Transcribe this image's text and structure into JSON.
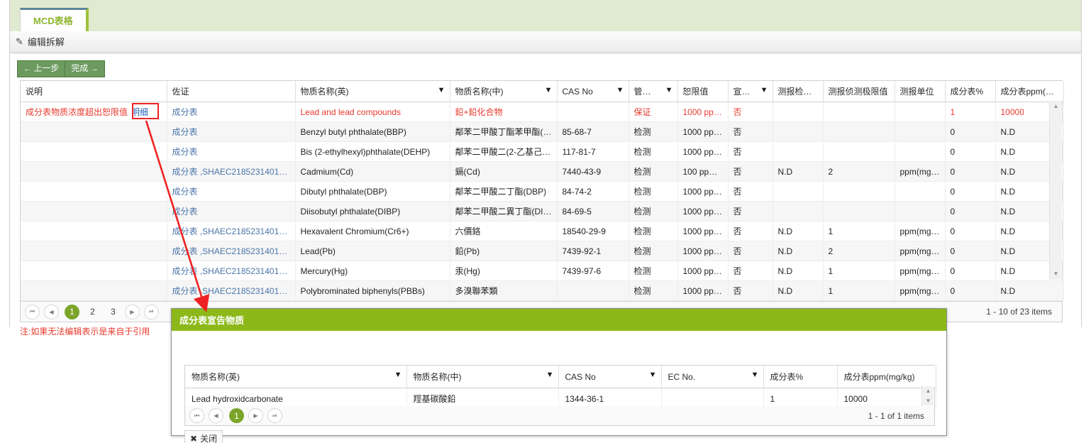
{
  "tab": {
    "label": "MCD表格"
  },
  "toolbar": {
    "icon": "pencil-edit-icon",
    "label": "编辑拆解"
  },
  "actions": {
    "prev_label": "上一步",
    "prev_arrow": "←",
    "done_label": "完成",
    "done_arrow": "→"
  },
  "grid": {
    "columns": [
      {
        "label": "说明",
        "filter": false
      },
      {
        "label": "佐证",
        "filter": false
      },
      {
        "label": "物质名称(英)",
        "filter": true
      },
      {
        "label": "物质名称(中)",
        "filter": true
      },
      {
        "label": "CAS No",
        "filter": true
      },
      {
        "label": "管…",
        "filter": true
      },
      {
        "label": "恕限值",
        "filter": false
      },
      {
        "label": "宣…",
        "filter": true
      },
      {
        "label": "测报检…",
        "filter": false
      },
      {
        "label": "测报侦测极限值",
        "filter": false
      },
      {
        "label": "测报单位",
        "filter": false
      },
      {
        "label": "成分表%",
        "filter": false
      },
      {
        "label": "成分表ppm(…",
        "filter": false
      }
    ],
    "rows": [
      {
        "note": "成分表物质浓度超出恕限值",
        "detail_link": "明细",
        "evidence": "成分表",
        "name_en": "Lead and lead compounds",
        "name_zh": "鉛+鉛化合物",
        "cas": "",
        "control": "保证",
        "limit": "1000 pp…",
        "declare": "否",
        "test_result": "",
        "test_detect_limit": "",
        "test_unit": "",
        "pct": "1",
        "ppm": "10000",
        "highlight": true
      },
      {
        "note": "",
        "detail_link": "",
        "evidence": "成分表",
        "name_en": "Benzyl butyl phthalate(BBP)",
        "name_zh": "鄰苯二甲酸丁酯苯甲酯(…",
        "cas": "85-68-7",
        "control": "检测",
        "limit": "1000 pp…",
        "declare": "否",
        "test_result": "",
        "test_detect_limit": "",
        "test_unit": "",
        "pct": "0",
        "ppm": "N.D",
        "highlight": false
      },
      {
        "note": "",
        "detail_link": "",
        "evidence": "成分表",
        "name_en": "Bis (2-ethylhexyl)phthalate(DEHP)",
        "name_zh": "鄰苯二甲酸二(2-乙基己…",
        "cas": "117-81-7",
        "control": "检测",
        "limit": "1000 pp…",
        "declare": "否",
        "test_result": "",
        "test_detect_limit": "",
        "test_unit": "",
        "pct": "0",
        "ppm": "N.D",
        "highlight": false
      },
      {
        "note": "",
        "detail_link": "",
        "evidence": "成分表 ,SHAEC2185231401/…",
        "name_en": "Cadmium(Cd)",
        "name_zh": "鎘(Cd)",
        "cas": "7440-43-9",
        "control": "检测",
        "limit": "100 pp…",
        "declare": "否",
        "test_result": "N.D",
        "test_detect_limit": "2",
        "test_unit": "ppm(mg…",
        "pct": "0",
        "ppm": "N.D",
        "highlight": false
      },
      {
        "note": "",
        "detail_link": "",
        "evidence": "成分表",
        "name_en": "Dibutyl phthalate(DBP)",
        "name_zh": "鄰苯二甲酸二丁酯(DBP)",
        "cas": "84-74-2",
        "control": "检测",
        "limit": "1000 pp…",
        "declare": "否",
        "test_result": "",
        "test_detect_limit": "",
        "test_unit": "",
        "pct": "0",
        "ppm": "N.D",
        "highlight": false
      },
      {
        "note": "",
        "detail_link": "",
        "evidence": "成分表",
        "name_en": "Diisobutyl phthalate(DIBP)",
        "name_zh": "鄰苯二甲酸二異丁酯(DI…",
        "cas": "84-69-5",
        "control": "检测",
        "limit": "1000 pp…",
        "declare": "否",
        "test_result": "",
        "test_detect_limit": "",
        "test_unit": "",
        "pct": "0",
        "ppm": "N.D",
        "highlight": false
      },
      {
        "note": "",
        "detail_link": "",
        "evidence": "成分表 ,SHAEC2185231401/…",
        "name_en": "Hexavalent Chromium(Cr6+)",
        "name_zh": "六價鉻",
        "cas": "18540-29-9",
        "control": "检测",
        "limit": "1000 pp…",
        "declare": "否",
        "test_result": "N.D",
        "test_detect_limit": "1",
        "test_unit": "ppm(mg…",
        "pct": "0",
        "ppm": "N.D",
        "highlight": false
      },
      {
        "note": "",
        "detail_link": "",
        "evidence": "成分表 ,SHAEC2185231401/…",
        "name_en": "Lead(Pb)",
        "name_zh": "鉛(Pb)",
        "cas": "7439-92-1",
        "control": "检测",
        "limit": "1000 pp…",
        "declare": "否",
        "test_result": "N.D",
        "test_detect_limit": "2",
        "test_unit": "ppm(mg…",
        "pct": "0",
        "ppm": "N.D",
        "highlight": false
      },
      {
        "note": "",
        "detail_link": "",
        "evidence": "成分表 ,SHAEC2185231401/…",
        "name_en": "Mercury(Hg)",
        "name_zh": "汞(Hg)",
        "cas": "7439-97-6",
        "control": "检测",
        "limit": "1000 pp…",
        "declare": "否",
        "test_result": "N.D",
        "test_detect_limit": "1",
        "test_unit": "ppm(mg…",
        "pct": "0",
        "ppm": "N.D",
        "highlight": false
      },
      {
        "note": "",
        "detail_link": "",
        "evidence": "成分表 ,SHAEC2185231401/…",
        "name_en": "Polybrominated biphenyls(PBBs)",
        "name_zh": "多溴聯苯類",
        "cas": "",
        "control": "检测",
        "limit": "1000 pp…",
        "declare": "否",
        "test_result": "N.D",
        "test_detect_limit": "1",
        "test_unit": "ppm(mg…",
        "pct": "0",
        "ppm": "N.D",
        "highlight": false
      }
    ],
    "pager": {
      "first": "⏮",
      "prev": "◀",
      "next": "▶",
      "last": "⏭",
      "pages": [
        "1",
        "2",
        "3"
      ],
      "active": "1",
      "info": "1 - 10 of 23 items"
    },
    "note": "注:如果无法编辑表示是来自于引用"
  },
  "dialog": {
    "title": "成分表宣告物质",
    "columns": [
      {
        "label": "物质名称(英)",
        "filter": true
      },
      {
        "label": "物质名称(中)",
        "filter": true
      },
      {
        "label": "CAS No",
        "filter": true
      },
      {
        "label": "EC No.",
        "filter": true
      },
      {
        "label": "成分表%",
        "filter": false
      },
      {
        "label": "成分表ppm(mg/kg)",
        "filter": false
      }
    ],
    "rows": [
      {
        "name_en": "Lead hydroxidcarbonate",
        "name_zh": "羥基碳酸鉛",
        "cas": "1344-36-1",
        "ec": "",
        "pct": "1",
        "ppm": "10000"
      }
    ],
    "pager": {
      "first": "⏮",
      "prev": "◀",
      "next": "▶",
      "last": "⏭",
      "pages": [
        "1"
      ],
      "active": "1",
      "info": "1 - 1 of 1 items"
    },
    "close_label": "关闭",
    "close_icon": "✖"
  },
  "colors": {
    "tab_strip": "#dfead0",
    "tab_text": "#8cb62e",
    "button_green": "#6c9a5f",
    "dialog_header": "#8cb819",
    "pager_active": "#7ba428",
    "alert_red": "#e8392c",
    "annotation_red": "#ee2222"
  }
}
